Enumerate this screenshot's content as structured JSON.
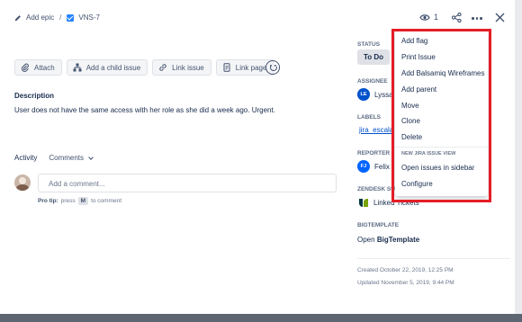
{
  "breadcrumb": {
    "epic_label": "Add epic",
    "separator": "/",
    "issue_key": "VNS-7"
  },
  "header": {
    "watch_count": "1"
  },
  "toolbar": {
    "attach": "Attach",
    "add_child": "Add a child issue",
    "link_issue": "Link issue",
    "link_page": "Link page"
  },
  "description": {
    "title": "Description",
    "text": "User does not have the same access with her role as she did a week ago. Urgent."
  },
  "activity": {
    "title": "Activity",
    "filter": "Comments",
    "comment_placeholder": "Add a comment...",
    "protip_label": "Pro tip:",
    "protip_press": "press",
    "protip_key": "M",
    "protip_rest": "to comment"
  },
  "side": {
    "status_label": "STATUS",
    "status_value": "To Do",
    "assignee_label": "ASSIGNEE",
    "assignee_initials": "LE",
    "assignee_name": "Lyssa",
    "labels_label": "LABELS",
    "label_value": "jira_escala",
    "reporter_label": "REPORTER",
    "reporter_initials": "FJ",
    "reporter_name": "Felix",
    "zendesk_label": "ZENDESK SUP",
    "linked_tickets": "Linked Tickets",
    "bigtemplate_label": "BIGTEMPLATE",
    "bigtemplate_prefix": "Open",
    "bigtemplate_name": "BigTemplate",
    "created": "Created October 22, 2019, 12:25 PM",
    "updated": "Updated November 5, 2019, 9:44 PM"
  },
  "menu": {
    "items": [
      "Add flag",
      "Print Issue",
      "Add Balsamiq Wireframes",
      "Add parent",
      "Move",
      "Clone",
      "Delete"
    ],
    "section_header": "NEW JIRA ISSUE VIEW",
    "section_items": [
      "Open issues in sidebar",
      "Configure"
    ]
  },
  "colors": {
    "highlight": "#e41e26",
    "link": "#0052cc",
    "avatar_assignee": "#0052cc",
    "avatar_reporter": "#0065ff",
    "issue_type": "#2684ff"
  }
}
